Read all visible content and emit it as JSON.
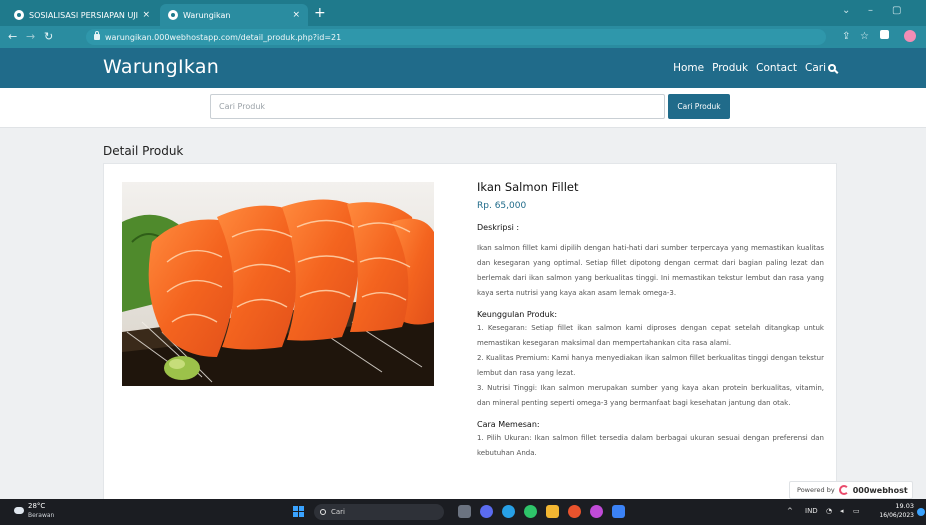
{
  "browser": {
    "tabs": [
      {
        "label": "SOSIALISASI PERSIAPAN UJI KOM"
      },
      {
        "label": "Warungikan"
      }
    ],
    "tab_close": "×",
    "new_tab": "+",
    "url": "warungikan.000webhostapp.com/detail_produk.php?id=21",
    "win_controls": [
      "⌄",
      "–",
      "▢"
    ]
  },
  "site": {
    "brand": "WarungIkan",
    "nav": [
      "Home",
      "Produk",
      "Contact",
      "Cari"
    ]
  },
  "search": {
    "placeholder": "Cari Produk",
    "button": "Cari Produk"
  },
  "page": {
    "section_title": "Detail Produk"
  },
  "product": {
    "name": "Ikan Salmon Fillet",
    "price": "Rp. 65,000",
    "desc_heading": "Deskripsi :",
    "description": "Ikan salmon fillet kami dipilih dengan hati-hati dari sumber terpercaya yang memastikan kualitas dan kesegaran yang optimal. Setiap fillet dipotong dengan cermat dari bagian paling lezat dan berlemak dari ikan salmon yang berkualitas tinggi. Ini memastikan tekstur lembut dan rasa yang kaya serta nutrisi yang kaya akan asam lemak omega-3.",
    "advantages_heading": "Keunggulan Produk:",
    "advantages": [
      "1. Kesegaran: Setiap fillet ikan salmon kami diproses dengan cepat setelah ditangkap untuk memastikan kesegaran maksimal dan mempertahankan cita rasa alami.",
      "2. Kualitas Premium: Kami hanya menyediakan ikan salmon fillet berkualitas tinggi dengan tekstur lembut dan rasa yang lezat.",
      "3. Nutrisi Tinggi: Ikan salmon merupakan sumber yang kaya akan protein berkualitas, vitamin, dan mineral penting seperti omega-3 yang bermanfaat bagi kesehatan jantung dan otak."
    ],
    "order_heading": "Cara Memesan:",
    "order_steps": [
      "1. Pilih Ukuran: Ikan salmon fillet tersedia dalam berbagai ukuran sesuai dengan preferensi dan kebutuhan Anda."
    ]
  },
  "powered": {
    "label": "Powered by",
    "logo": "000webhost"
  },
  "taskbar": {
    "temp": "28°C",
    "weather": "Berawan",
    "search_label": "Cari",
    "lang": "IND",
    "time": "19.03",
    "date": "16/06/2023",
    "tray_caret": "^"
  },
  "colors": {
    "header": "#206b8a",
    "browser_frame": "#1f7a8c",
    "price": "#206b8a"
  }
}
